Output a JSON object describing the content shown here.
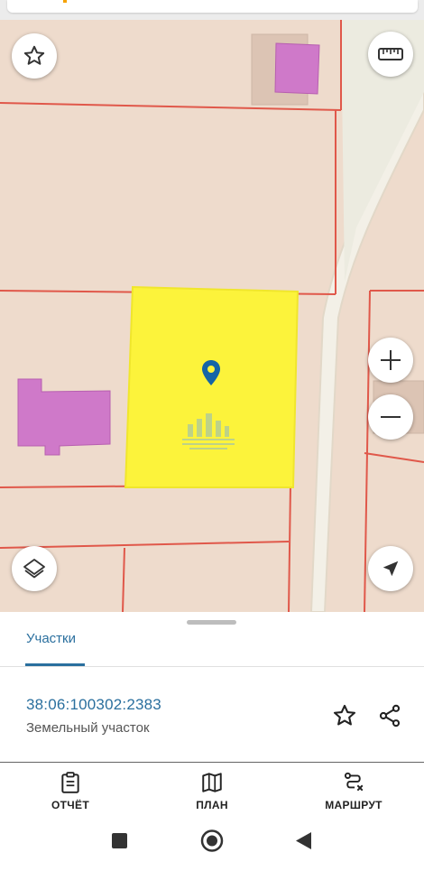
{
  "map": {
    "background": "#eedbcc",
    "selected_fill": "#fcf33b",
    "building_fill": "#cf79c9",
    "boundary_color": "#e0584a",
    "road_fill": "#f3f0e7",
    "icons": {
      "favorite": "star-outline-icon",
      "ruler": "ruler-icon",
      "zoom_in": "plus-icon",
      "zoom_out": "minus-icon",
      "layers": "layers-icon",
      "locate": "navigation-arrow-icon",
      "pin": "map-pin-icon"
    }
  },
  "sheet": {
    "tab_label": "Участки",
    "parcel": {
      "number": "38:06:100302:2383",
      "type": "Земельный участок"
    }
  },
  "bottom_nav": {
    "report": "ОТЧЁТ",
    "plan": "ПЛАН",
    "route": "МАРШРУТ"
  },
  "system_nav": [
    "recents",
    "home",
    "back"
  ]
}
